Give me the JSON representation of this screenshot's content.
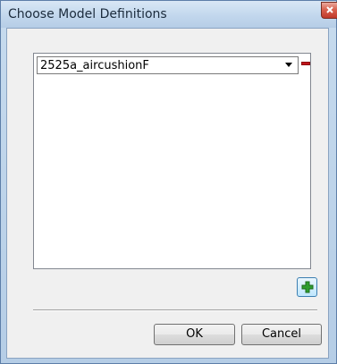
{
  "window": {
    "title": "Choose Model Definitions",
    "close_icon": "close-icon"
  },
  "model_list": {
    "rows": [
      {
        "selected_value": "2525a_aircushionF",
        "dropdown_icon": "chevron-down-icon",
        "remove_icon": "minus-icon",
        "remove_color": "#c0141b"
      }
    ]
  },
  "add_button": {
    "icon": "plus-icon",
    "icon_color": "#2e9e2e"
  },
  "footer": {
    "ok_label": "OK",
    "cancel_label": "Cancel"
  },
  "colors": {
    "title_bar": "#c2d7ed",
    "client_bg": "#f0f0f0",
    "close_button": "#c0392b"
  }
}
